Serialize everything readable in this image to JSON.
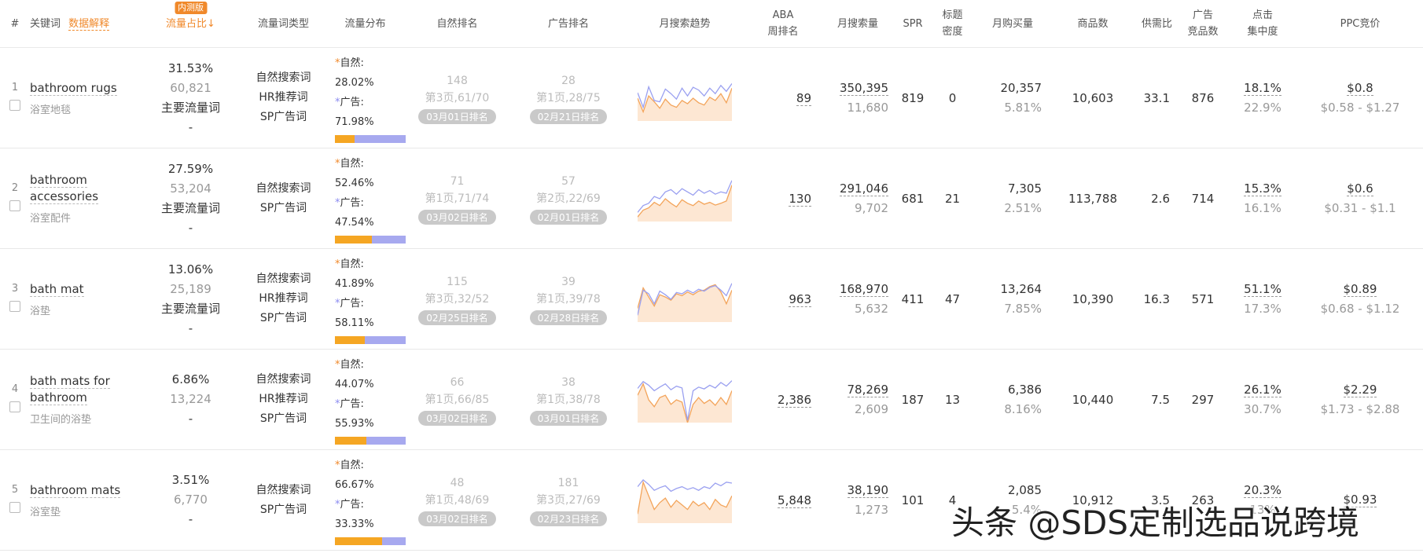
{
  "headers": {
    "num": "#",
    "keyword": "关键词",
    "keyword_link": "数据解释",
    "beta": "内测版",
    "share": "流量占比",
    "share_sort": "↓",
    "type": "流量词类型",
    "dist": "流量分布",
    "natural": "自然排名",
    "ad": "广告排名",
    "trend": "月搜索趋势",
    "aba": "ABA\n周排名",
    "monthly": "月搜索量",
    "spr": "SPR",
    "density": "标题\n密度",
    "purchase": "月购买量",
    "products": "商品数",
    "supply": "供需比",
    "adprod": "广告\n竞品数",
    "click": "点击\n集中度",
    "ppc": "PPC竞价"
  },
  "labels": {
    "natural": "自然:",
    "ad": "广告:"
  },
  "rows": [
    {
      "idx": "1",
      "en": "bathroom rugs",
      "cn": "浴室地毯",
      "share": "31.53%",
      "share_num": "60,821",
      "share_tag": "主要流量词",
      "share_dash": "-",
      "types": [
        "自然搜索词",
        "HR推荐词",
        "SP广告词"
      ],
      "nat_pct": "28.02%",
      "ad_pct": "71.98%",
      "nat_frac": 0.2802,
      "nat_rank": "148",
      "nat_page": "第3页,61/70",
      "nat_date": "03月01日排名",
      "ad_rank": "28",
      "ad_page": "第1页,28/75",
      "ad_date": "02月21日排名",
      "trend_blue": [
        62,
        30,
        75,
        45,
        42,
        70,
        60,
        48,
        72,
        55,
        74,
        68,
        55,
        72,
        60,
        78,
        65,
        82
      ],
      "trend_orange": [
        50,
        20,
        55,
        42,
        28,
        48,
        35,
        30,
        45,
        38,
        50,
        40,
        35,
        52,
        45,
        60,
        40,
        72
      ],
      "aba": "89",
      "monthly": "350,395",
      "monthly_sub": "11,680",
      "spr": "819",
      "density": "0",
      "purchase": "20,357",
      "purchase_pct": "5.81%",
      "products": "10,603",
      "supply": "33.1",
      "adprod": "876",
      "click": "18.1%",
      "click_sub": "22.9%",
      "ppc": "$0.8",
      "ppc_range": "$0.58 - $1.27"
    },
    {
      "idx": "2",
      "en": "bathroom accessories",
      "cn": "浴室配件",
      "share": "27.59%",
      "share_num": "53,204",
      "share_tag": "主要流量词",
      "share_dash": "-",
      "types": [
        "自然搜索词",
        "SP广告词"
      ],
      "nat_pct": "52.46%",
      "ad_pct": "47.54%",
      "nat_frac": 0.5246,
      "nat_rank": "71",
      "nat_page": "第1页,71/74",
      "nat_date": "03月02日排名",
      "ad_rank": "57",
      "ad_page": "第2页,22/69",
      "ad_date": "02月01日排名",
      "trend_blue": [
        20,
        35,
        40,
        55,
        50,
        65,
        70,
        60,
        72,
        65,
        58,
        70,
        62,
        68,
        60,
        65,
        62,
        90
      ],
      "trend_orange": [
        10,
        25,
        30,
        42,
        35,
        50,
        40,
        32,
        48,
        40,
        35,
        45,
        38,
        42,
        36,
        40,
        45,
        80
      ],
      "aba": "130",
      "monthly": "291,046",
      "monthly_sub": "9,702",
      "spr": "681",
      "density": "21",
      "purchase": "7,305",
      "purchase_pct": "2.51%",
      "products": "113,788",
      "supply": "2.6",
      "adprod": "714",
      "click": "15.3%",
      "click_sub": "16.1%",
      "ppc": "$0.6",
      "ppc_range": "$0.31 - $1.1"
    },
    {
      "idx": "3",
      "en": "bath mat",
      "cn": "浴垫",
      "share": "13.06%",
      "share_num": "25,189",
      "share_tag": "主要流量词",
      "share_dash": "-",
      "types": [
        "自然搜索词",
        "HR推荐词",
        "SP广告词"
      ],
      "nat_pct": "41.89%",
      "ad_pct": "58.11%",
      "nat_frac": 0.4189,
      "nat_rank": "115",
      "nat_page": "第3页,32/52",
      "nat_date": "02月25日排名",
      "ad_rank": "39",
      "ad_page": "第1页,39/78",
      "ad_date": "02月28日排名",
      "trend_blue": [
        15,
        70,
        62,
        40,
        68,
        60,
        50,
        65,
        62,
        70,
        64,
        72,
        68,
        76,
        80,
        70,
        58,
        85
      ],
      "trend_orange": [
        30,
        75,
        55,
        35,
        60,
        55,
        48,
        62,
        58,
        66,
        60,
        68,
        70,
        78,
        82,
        66,
        40,
        70
      ],
      "aba": "963",
      "monthly": "168,970",
      "monthly_sub": "5,632",
      "spr": "411",
      "density": "47",
      "purchase": "13,264",
      "purchase_pct": "7.85%",
      "products": "10,390",
      "supply": "16.3",
      "adprod": "571",
      "click": "51.1%",
      "click_sub": "17.3%",
      "ppc": "$0.89",
      "ppc_range": "$0.68 - $1.12"
    },
    {
      "idx": "4",
      "en": "bath mats for bathroom",
      "cn": "卫生间的浴垫",
      "share": "6.86%",
      "share_num": "13,224",
      "share_tag": "",
      "share_dash": "-",
      "types": [
        "自然搜索词",
        "HR推荐词",
        "SP广告词"
      ],
      "nat_pct": "44.07%",
      "ad_pct": "55.93%",
      "nat_frac": 0.4407,
      "nat_rank": "66",
      "nat_page": "第1页,66/85",
      "nat_date": "03月02日排名",
      "ad_rank": "38",
      "ad_page": "第1页,38/78",
      "ad_date": "03月01日排名",
      "trend_blue": [
        75,
        90,
        82,
        70,
        78,
        85,
        72,
        80,
        76,
        5,
        70,
        78,
        74,
        82,
        76,
        88,
        80,
        92
      ],
      "trend_orange": [
        60,
        85,
        50,
        35,
        55,
        60,
        40,
        50,
        45,
        0,
        40,
        55,
        42,
        50,
        38,
        55,
        40,
        70
      ],
      "aba": "2,386",
      "monthly": "78,269",
      "monthly_sub": "2,609",
      "spr": "187",
      "density": "13",
      "purchase": "6,386",
      "purchase_pct": "8.16%",
      "products": "10,440",
      "supply": "7.5",
      "adprod": "297",
      "click": "26.1%",
      "click_sub": "30.7%",
      "ppc": "$2.29",
      "ppc_range": "$1.73 - $2.88"
    },
    {
      "idx": "5",
      "en": "bathroom mats",
      "cn": "浴室垫",
      "share": "3.51%",
      "share_num": "6,770",
      "share_tag": "",
      "share_dash": "-",
      "types": [
        "自然搜索词",
        "SP广告词"
      ],
      "nat_pct": "66.67%",
      "ad_pct": "33.33%",
      "nat_frac": 0.6667,
      "nat_rank": "48",
      "nat_page": "第1页,48/69",
      "nat_date": "03月02日排名",
      "ad_rank": "181",
      "ad_page": "第3页,27/69",
      "ad_date": "02月23日排名",
      "trend_blue": [
        80,
        95,
        85,
        72,
        78,
        82,
        70,
        76,
        80,
        74,
        78,
        72,
        80,
        76,
        88,
        82,
        90,
        88
      ],
      "trend_orange": [
        20,
        90,
        60,
        30,
        45,
        55,
        35,
        50,
        40,
        30,
        48,
        38,
        45,
        30,
        52,
        40,
        35,
        60
      ],
      "aba": "5,848",
      "monthly": "38,190",
      "monthly_sub": "1,273",
      "spr": "101",
      "density": "4",
      "purchase": "2,085",
      "purchase_pct": "5.4%",
      "products": "10,912",
      "supply": "3.5",
      "adprod": "263",
      "click": "20.3%",
      "click_sub": "13%",
      "ppc": "$0.93",
      "ppc_range": ""
    }
  ],
  "colors": {
    "accent": "#f0892b",
    "natural": "#f5a623",
    "ad": "#a7a9ef",
    "trend_blue": "#9aa0f0",
    "trend_orange": "#f3a45a"
  },
  "watermark": "头条 @SDS定制选品说跨境"
}
